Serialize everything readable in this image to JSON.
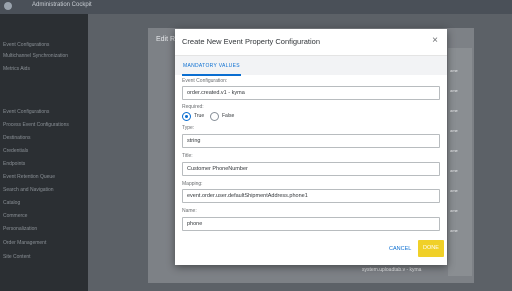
{
  "app": {
    "title": "Administration Cockpit",
    "sidebar_items": [
      "Event Configurations",
      "Multichannel Synchronization",
      "Metrics Aids",
      "Event Configurations",
      "Process Event Configurations",
      "Destinations",
      "Credentials",
      "Endpoints",
      "Event Retention Queue",
      "Search and Navigation",
      "Catalog",
      "Commerce",
      "Personalization",
      "Order Management",
      "Site Content"
    ],
    "background_card_title": "Edit R",
    "background_right_values": [
      "ame",
      "ame",
      "ame",
      "ame",
      "ame",
      "ame",
      "ame",
      "ame",
      "ame"
    ],
    "background_bottom_text": "system.uploadtab.v - kyma"
  },
  "modal": {
    "title": "Create New Event Property Configuration",
    "tab_label": "MANDATORY VALUES",
    "event_configuration_label": "Event Configuration:",
    "event_configuration_value": "order.created.v1 - kyma",
    "required_label": "Required:",
    "true_label": "True",
    "false_label": "False",
    "required_selected": "True",
    "type_label": "Type:",
    "type_value": "string",
    "title_label": "Title:",
    "title_value": "Customer PhoneNumber",
    "mapping_label": "Mapping:",
    "mapping_value": "event.order.user.defaultShipmentAddress.phone1",
    "name_label": "Name:",
    "name_value": "phone",
    "cancel_label": "CANCEL",
    "done_label": "DONE"
  },
  "colors": {
    "accent": "#0a6ed1",
    "done_button": "#f0d028",
    "overlay": "#3a3f45"
  },
  "icons": {
    "close": "close-icon"
  }
}
